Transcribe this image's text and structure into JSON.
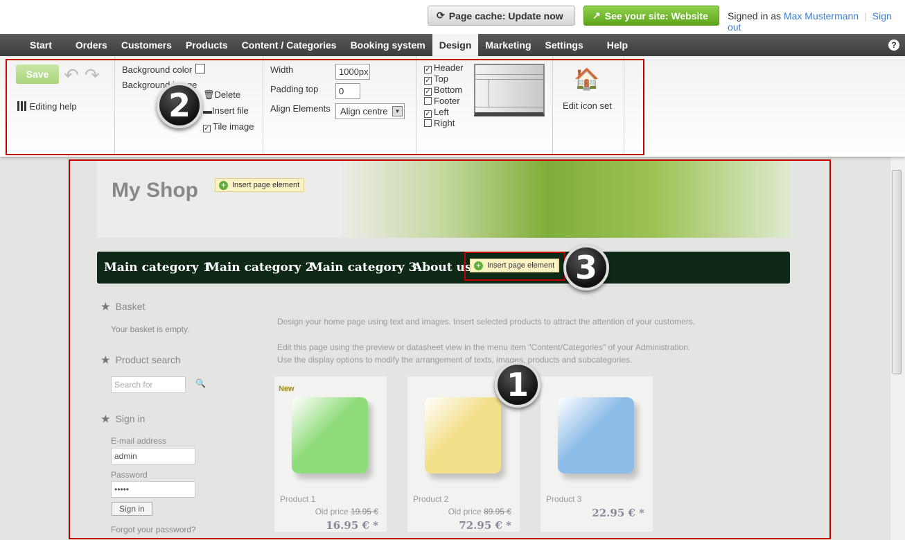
{
  "topbar": {
    "cache_button": "Page cache: Update now",
    "site_button": "See your site: Website",
    "signed_in_prefix": "Signed in as",
    "user": "Max Mustermann",
    "sign_out": "Sign out"
  },
  "nav": {
    "items": [
      "Start",
      "Orders",
      "Customers",
      "Products",
      "Content / Categories",
      "Booking system",
      "Design",
      "Marketing",
      "Settings",
      "Help"
    ],
    "active": "Design",
    "help_icon": "?"
  },
  "toolbar": {
    "save": "Save",
    "editing_help": "Editing help",
    "background_color": "Background color",
    "background_image": "Background image",
    "delete": "Delete",
    "insert_file": "Insert file",
    "tile_image": "Tile image",
    "tile_checked": true,
    "width_label": "Width",
    "width_value": "1000px",
    "padding_label": "Padding top",
    "padding_value": "0",
    "align_label": "Align Elements",
    "align_value": "Align centre",
    "layout": [
      {
        "label": "Header",
        "checked": true
      },
      {
        "label": "Top",
        "checked": true
      },
      {
        "label": "Bottom",
        "checked": true
      },
      {
        "label": "Footer",
        "checked": false
      },
      {
        "label": "Left",
        "checked": true
      },
      {
        "label": "Right",
        "checked": false
      }
    ],
    "edit_icon_set": "Edit icon set"
  },
  "badges": [
    "1",
    "2",
    "3"
  ],
  "shop": {
    "name": "My Shop",
    "insert_page_element": "Insert page element",
    "categories": [
      "Main category 1",
      "Main category 2",
      "Main category 3",
      "About us"
    ],
    "sidebar": {
      "basket": "Basket",
      "basket_text": "Your basket is empty.",
      "search": "Product search",
      "search_placeholder": "Search for",
      "signin": "Sign in",
      "email_label": "E-mail address",
      "email_value": "admin",
      "password_label": "Password",
      "password_value": "•••••",
      "signin_button": "Sign in",
      "forgot": "Forgot your password?"
    },
    "intro": [
      "Design your home page using text and images. Insert selected products to attract the attention of your customers.",
      "Edit this page using the preview or datasheet view in the menu item \"Content/Categories\" of your Administration.",
      "Use the display options to modify the arrangement of texts, images, products and subcategories."
    ],
    "new_label": "New",
    "old_price_label": "Old price",
    "products": [
      {
        "name": "Product 1",
        "old_price": "19.95 €",
        "price": "16.95 € *",
        "color": "#8fdc7a"
      },
      {
        "name": "Product 2",
        "old_price": "89.95 €",
        "price": "72.95 € *",
        "color": "#f3e08a"
      },
      {
        "name": "Product 3",
        "old_price": "",
        "price": "22.95 € *",
        "color": "#8cbde8"
      }
    ]
  }
}
